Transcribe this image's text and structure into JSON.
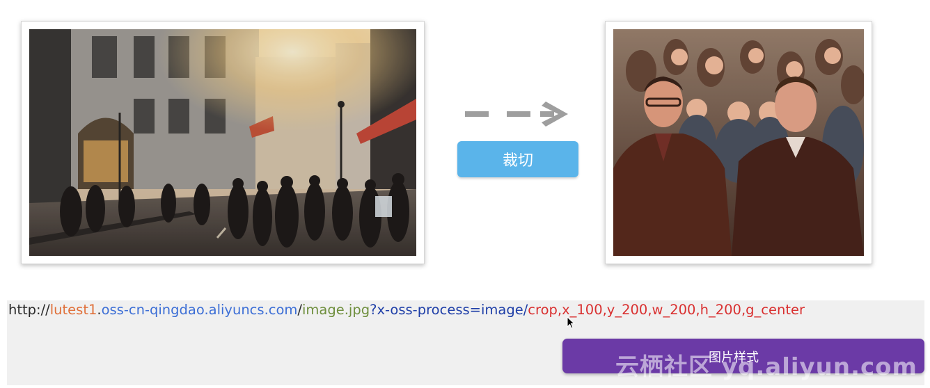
{
  "crop_button": {
    "label": "裁切"
  },
  "url": {
    "protocol": "http://",
    "bucket": "lutest1",
    "dot": ".",
    "endpoint": "oss-cn-qingdao.aliyuncs.com",
    "slash": "/",
    "object": "image.jpg",
    "process_prefix": "?x-oss-process=image/",
    "params": "crop,x_100,y_200,w_200,h_200,g_center"
  },
  "style_button": {
    "label": "图片样式"
  },
  "watermark": {
    "text": "云栖社区 yq.aliyun.com"
  },
  "images": {
    "source": {
      "name": "street-crowd-photo"
    },
    "result": {
      "name": "cropped-crowd-photo"
    }
  },
  "colors": {
    "crop_button": "#5ab4ea",
    "style_button": "#6b3aa6",
    "url_bucket": "#e0703a",
    "url_endpoint": "#3d6fd6",
    "url_object": "#6f8f3e",
    "url_process": "#1f3fa8",
    "url_params": "#d93030"
  }
}
